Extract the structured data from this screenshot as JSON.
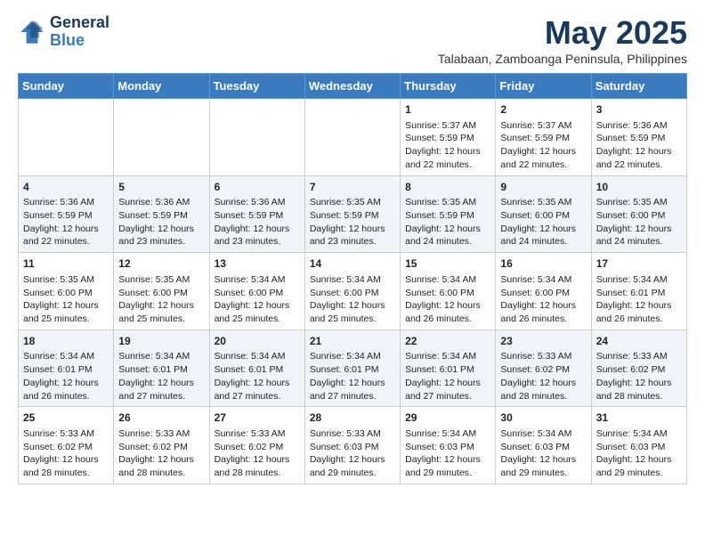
{
  "header": {
    "logo_line1": "General",
    "logo_line2": "Blue",
    "month_year": "May 2025",
    "location": "Talabaan, Zamboanga Peninsula, Philippines"
  },
  "days_of_week": [
    "Sunday",
    "Monday",
    "Tuesday",
    "Wednesday",
    "Thursday",
    "Friday",
    "Saturday"
  ],
  "weeks": [
    [
      {
        "day": "",
        "content": ""
      },
      {
        "day": "",
        "content": ""
      },
      {
        "day": "",
        "content": ""
      },
      {
        "day": "",
        "content": ""
      },
      {
        "day": "1",
        "content": "Sunrise: 5:37 AM\nSunset: 5:59 PM\nDaylight: 12 hours\nand 22 minutes."
      },
      {
        "day": "2",
        "content": "Sunrise: 5:37 AM\nSunset: 5:59 PM\nDaylight: 12 hours\nand 22 minutes."
      },
      {
        "day": "3",
        "content": "Sunrise: 5:36 AM\nSunset: 5:59 PM\nDaylight: 12 hours\nand 22 minutes."
      }
    ],
    [
      {
        "day": "4",
        "content": "Sunrise: 5:36 AM\nSunset: 5:59 PM\nDaylight: 12 hours\nand 22 minutes."
      },
      {
        "day": "5",
        "content": "Sunrise: 5:36 AM\nSunset: 5:59 PM\nDaylight: 12 hours\nand 23 minutes."
      },
      {
        "day": "6",
        "content": "Sunrise: 5:36 AM\nSunset: 5:59 PM\nDaylight: 12 hours\nand 23 minutes."
      },
      {
        "day": "7",
        "content": "Sunrise: 5:35 AM\nSunset: 5:59 PM\nDaylight: 12 hours\nand 23 minutes."
      },
      {
        "day": "8",
        "content": "Sunrise: 5:35 AM\nSunset: 5:59 PM\nDaylight: 12 hours\nand 24 minutes."
      },
      {
        "day": "9",
        "content": "Sunrise: 5:35 AM\nSunset: 6:00 PM\nDaylight: 12 hours\nand 24 minutes."
      },
      {
        "day": "10",
        "content": "Sunrise: 5:35 AM\nSunset: 6:00 PM\nDaylight: 12 hours\nand 24 minutes."
      }
    ],
    [
      {
        "day": "11",
        "content": "Sunrise: 5:35 AM\nSunset: 6:00 PM\nDaylight: 12 hours\nand 25 minutes."
      },
      {
        "day": "12",
        "content": "Sunrise: 5:35 AM\nSunset: 6:00 PM\nDaylight: 12 hours\nand 25 minutes."
      },
      {
        "day": "13",
        "content": "Sunrise: 5:34 AM\nSunset: 6:00 PM\nDaylight: 12 hours\nand 25 minutes."
      },
      {
        "day": "14",
        "content": "Sunrise: 5:34 AM\nSunset: 6:00 PM\nDaylight: 12 hours\nand 25 minutes."
      },
      {
        "day": "15",
        "content": "Sunrise: 5:34 AM\nSunset: 6:00 PM\nDaylight: 12 hours\nand 26 minutes."
      },
      {
        "day": "16",
        "content": "Sunrise: 5:34 AM\nSunset: 6:00 PM\nDaylight: 12 hours\nand 26 minutes."
      },
      {
        "day": "17",
        "content": "Sunrise: 5:34 AM\nSunset: 6:01 PM\nDaylight: 12 hours\nand 26 minutes."
      }
    ],
    [
      {
        "day": "18",
        "content": "Sunrise: 5:34 AM\nSunset: 6:01 PM\nDaylight: 12 hours\nand 26 minutes."
      },
      {
        "day": "19",
        "content": "Sunrise: 5:34 AM\nSunset: 6:01 PM\nDaylight: 12 hours\nand 27 minutes."
      },
      {
        "day": "20",
        "content": "Sunrise: 5:34 AM\nSunset: 6:01 PM\nDaylight: 12 hours\nand 27 minutes."
      },
      {
        "day": "21",
        "content": "Sunrise: 5:34 AM\nSunset: 6:01 PM\nDaylight: 12 hours\nand 27 minutes."
      },
      {
        "day": "22",
        "content": "Sunrise: 5:34 AM\nSunset: 6:01 PM\nDaylight: 12 hours\nand 27 minutes."
      },
      {
        "day": "23",
        "content": "Sunrise: 5:33 AM\nSunset: 6:02 PM\nDaylight: 12 hours\nand 28 minutes."
      },
      {
        "day": "24",
        "content": "Sunrise: 5:33 AM\nSunset: 6:02 PM\nDaylight: 12 hours\nand 28 minutes."
      }
    ],
    [
      {
        "day": "25",
        "content": "Sunrise: 5:33 AM\nSunset: 6:02 PM\nDaylight: 12 hours\nand 28 minutes."
      },
      {
        "day": "26",
        "content": "Sunrise: 5:33 AM\nSunset: 6:02 PM\nDaylight: 12 hours\nand 28 minutes."
      },
      {
        "day": "27",
        "content": "Sunrise: 5:33 AM\nSunset: 6:02 PM\nDaylight: 12 hours\nand 28 minutes."
      },
      {
        "day": "28",
        "content": "Sunrise: 5:33 AM\nSunset: 6:03 PM\nDaylight: 12 hours\nand 29 minutes."
      },
      {
        "day": "29",
        "content": "Sunrise: 5:34 AM\nSunset: 6:03 PM\nDaylight: 12 hours\nand 29 minutes."
      },
      {
        "day": "30",
        "content": "Sunrise: 5:34 AM\nSunset: 6:03 PM\nDaylight: 12 hours\nand 29 minutes."
      },
      {
        "day": "31",
        "content": "Sunrise: 5:34 AM\nSunset: 6:03 PM\nDaylight: 12 hours\nand 29 minutes."
      }
    ]
  ]
}
